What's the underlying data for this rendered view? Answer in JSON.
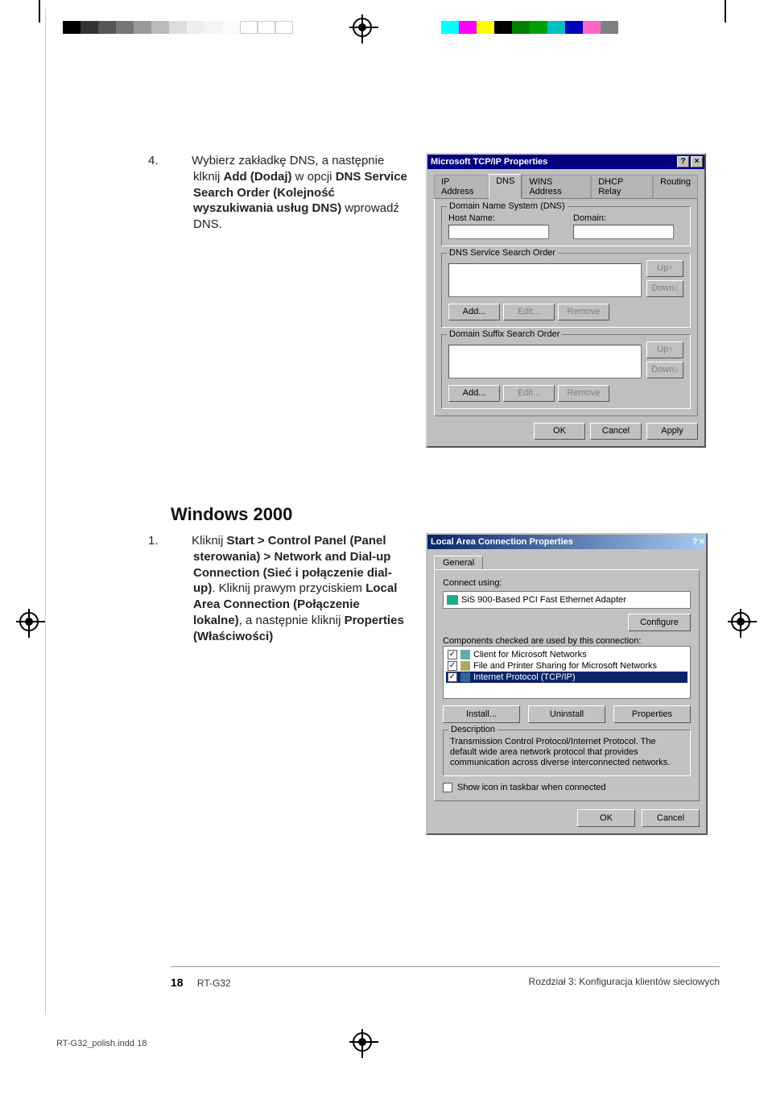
{
  "step4": {
    "num": "4.",
    "text_a": "Wybierz zakładkę DNS, a następnie klknij ",
    "bold_a": "Add (Dodaj)",
    "text_b": " w opcji ",
    "bold_b": "DNS Service Search Order (Kolejność wyszukiwania usług DNS)",
    "text_c": " wprowadź DNS."
  },
  "dlg98": {
    "title": "Microsoft TCP/IP Properties",
    "help": "?",
    "close": "×",
    "tabs": [
      "IP Address",
      "DNS",
      "WINS Address",
      "DHCP Relay",
      "Routing"
    ],
    "group_hostdomain": "Domain Name System (DNS)",
    "lbl_host": "Host Name:",
    "lbl_domain": "Domain:",
    "group_dns": "DNS Service Search Order",
    "group_suffix": "Domain Suffix Search Order",
    "btn_up": "Up↑",
    "btn_down": "Down↓",
    "btn_add": "Add...",
    "btn_edit": "Edit...",
    "btn_remove": "Remove",
    "btn_ok": "OK",
    "btn_cancel": "Cancel",
    "btn_apply": "Apply"
  },
  "section_heading": "Windows   2000",
  "step1": {
    "num": "1.",
    "t1": "Kliknij ",
    "b1": "Start > Control Panel (Panel sterowania) > Network and Dial-up Connection (Sieć i połączenie dial-up)",
    "t2": ". Kliknij prawym przyciskiem ",
    "b2": "Local Area Connection (Połączenie lokalne)",
    "t3": ", a następnie kliknij ",
    "b3": "Properties (Właściwości)"
  },
  "dlg2k": {
    "title": "Local Area Connection Properties",
    "help": "?",
    "close": "×",
    "tab": "General",
    "lbl_connect": "Connect using:",
    "adapter": "SiS 900-Based PCI Fast Ethernet Adapter",
    "btn_configure": "Configure",
    "lbl_components": "Components checked are used by this connection:",
    "items": [
      "Client for Microsoft Networks",
      "File and Printer Sharing for Microsoft Networks",
      "Internet Protocol (TCP/IP)"
    ],
    "btn_install": "Install...",
    "btn_uninstall": "Uninstall",
    "btn_properties": "Properties",
    "grp_desc": "Description",
    "desc": "Transmission Control Protocol/Internet Protocol. The default wide area network protocol that provides communication across diverse interconnected networks.",
    "chk_taskbar": "Show icon in taskbar when connected",
    "btn_ok": "OK",
    "btn_cancel": "Cancel"
  },
  "footer": {
    "page": "18",
    "model": "RT-G32",
    "chapter": "Rozdział 3: Konfiguracja klientów sieciowych"
  },
  "indd": "RT-G32_polish.indd   18"
}
